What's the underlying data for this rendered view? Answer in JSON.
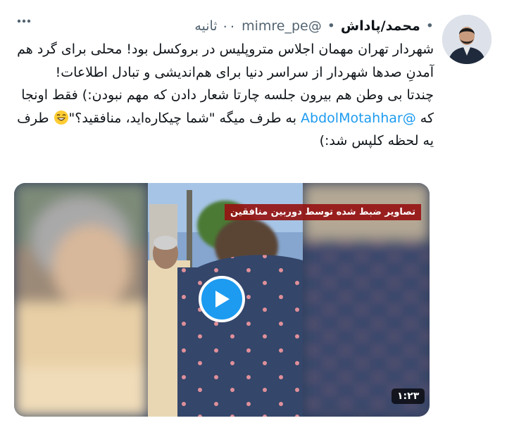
{
  "tweet": {
    "display_name": "محمد/پاداش",
    "handle": "@mimre_pe",
    "time": "۰۰ ثانیه",
    "paragraphs": [
      {
        "text": "شهردار تهران مهمان اجلاس متروپلیس در بروکسل بود! محلی برای گرد هم آمدنِ صدها شهردار از سراسر دنیا برای هم‌اندیشی و تبادل اطلاعات!"
      },
      {
        "before": "چندتا بی وطن هم بیرون جلسه چارتا شعار دادن که مهم نبودن:) فقط اونجا که ",
        "mention": "@AbdolMotahhar",
        "middle": " به طرف میگه \"شما چیکاره‌اید، منافقید؟\"",
        "after": " طرف یه لحظه کلپس شد:)"
      }
    ]
  },
  "video": {
    "caption": "تصاویر ضبط شده توسط دوربین منافقین",
    "duration": "۱:۲۳"
  },
  "icons": {
    "more": "more-options-icon",
    "play": "play-icon",
    "emoji": "laughing-emoji-icon"
  },
  "colors": {
    "link": "#1d9bf0",
    "secondary_text": "#536471",
    "caption_background": "#961414"
  }
}
